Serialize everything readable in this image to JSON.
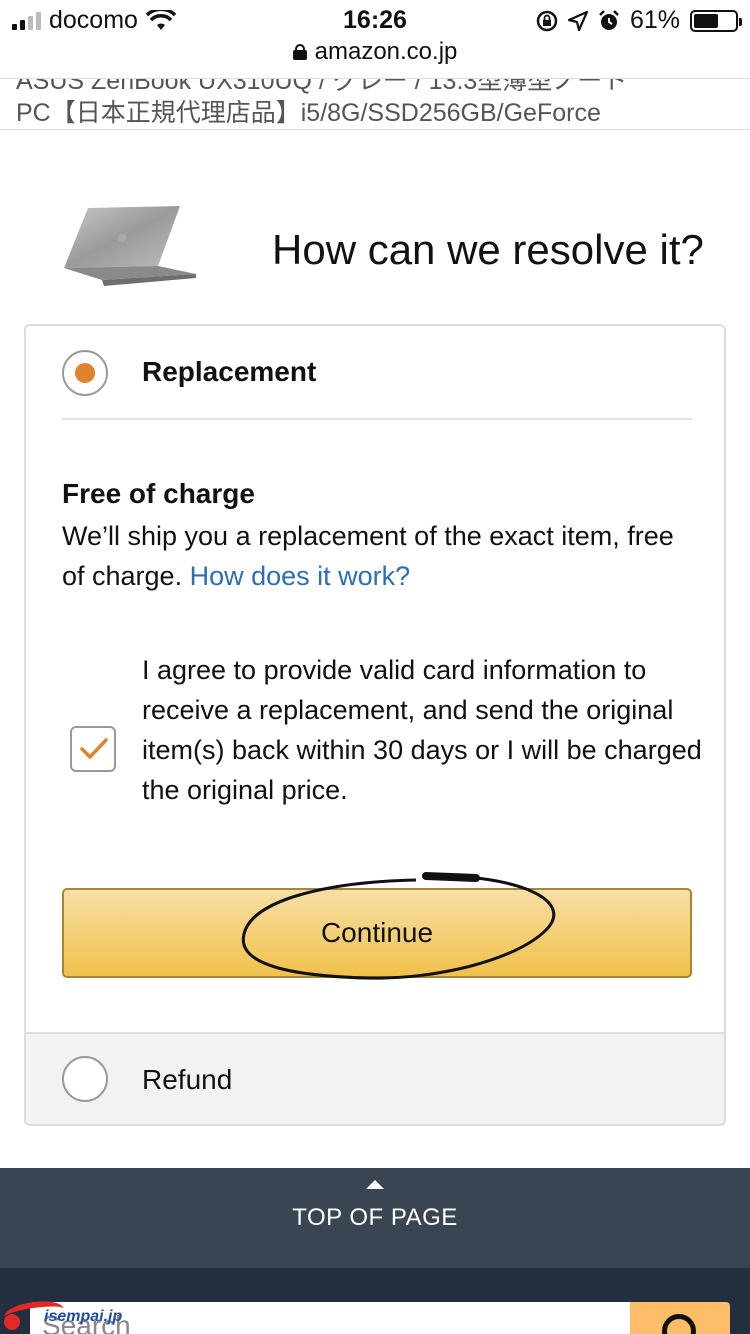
{
  "status_bar": {
    "carrier": "docomo",
    "time": "16:26",
    "battery_percent": "61%",
    "battery_level": 0.61,
    "icons": [
      "signal-icon",
      "wifi-icon",
      "rotation-lock-icon",
      "location-icon",
      "alarm-icon",
      "battery-icon"
    ]
  },
  "url_bar": {
    "domain": "amazon.co.jp",
    "icon": "lock-icon"
  },
  "product": {
    "title_cut_line": "ASUS ZenBook UX310UQ / グレー / 13.3型薄型ノート",
    "title_line": "PC【日本正規代理店品】i5/8G/SSD256GB/GeForce"
  },
  "header": {
    "question": "How can we resolve it?"
  },
  "options": {
    "replacement": {
      "label": "Replacement",
      "selected": true,
      "heading": "Free of charge",
      "description": "We’ll ship you a replacement of the exact item, free of charge.",
      "link": "How does it work?",
      "agreement": "I agree to provide valid card information to receive a replacement, and send the original item(s) back within 30 days or I will be charged the original price.",
      "agreement_checked": true,
      "continue_label": "Continue"
    },
    "refund": {
      "label": "Refund",
      "selected": false
    }
  },
  "colors": {
    "radio_selected": "#e0832e",
    "checkmark": "#e0832e",
    "link": "#2f6db3",
    "button_top": "#f7dfa5",
    "button_bottom": "#f0c14b",
    "footer": "#3a4553",
    "footer_bottom": "#232f3e",
    "search_button": "#febd69"
  },
  "footer": {
    "top_label": "TOP OF PAGE",
    "search_placeholder": "Search"
  },
  "watermark": {
    "text": "isempai.jp"
  }
}
